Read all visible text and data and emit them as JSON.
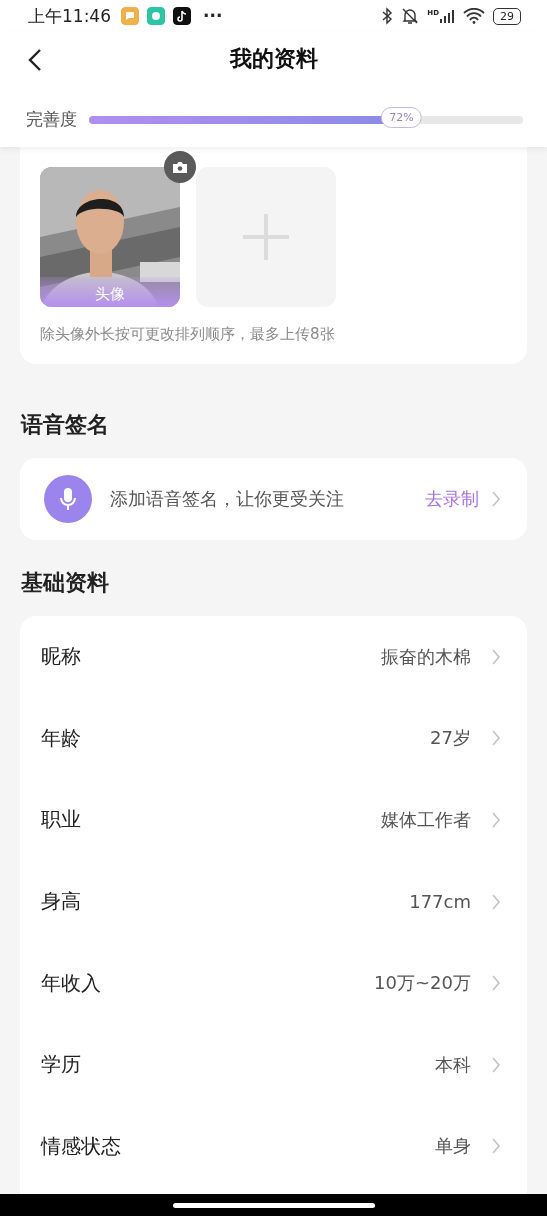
{
  "status_bar": {
    "time": "上午11:46",
    "more": "···",
    "signal_label": "HD",
    "battery": "29"
  },
  "header": {
    "title": "我的资料"
  },
  "completeness": {
    "label": "完善度",
    "level": 0.72,
    "reading": "72%"
  },
  "photos": {
    "items": [
      {
        "kind": "picture",
        "caption": "头像"
      },
      {
        "kind": "add"
      }
    ],
    "hint": "除头像外长按可更改排列顺序，最多上传8张"
  },
  "voice_section": {
    "title": "语音签名",
    "prompt": "添加语音签名，让你更受关注",
    "action": "去录制"
  },
  "basic_section": {
    "title": "基础资料",
    "rows": [
      {
        "label": "昵称",
        "value": "振奋的木棉"
      },
      {
        "label": "年龄",
        "value": "27岁"
      },
      {
        "label": "职业",
        "value": "媒体工作者"
      },
      {
        "label": "身高",
        "value": "177cm"
      },
      {
        "label": "年收入",
        "value": "10万~20万"
      },
      {
        "label": "学历",
        "value": "本科"
      },
      {
        "label": "情感状态",
        "value": "单身"
      }
    ]
  }
}
